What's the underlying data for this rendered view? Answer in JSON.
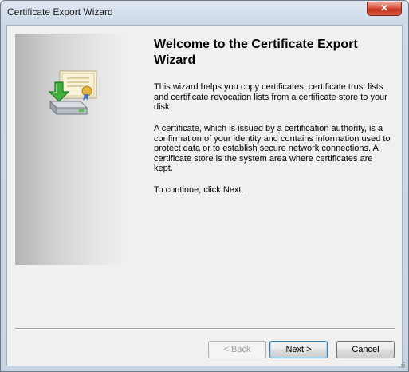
{
  "window": {
    "title": "Certificate Export Wizard",
    "close_label": "✕"
  },
  "wizard": {
    "heading": "Welcome to the Certificate Export Wizard",
    "paragraphs": [
      "This wizard helps you copy certificates, certificate trust lists and certificate revocation lists from a certificate store to your disk.",
      "A certificate, which is issued by a certification authority, is a confirmation of your identity and contains information used to protect data or to establish secure network connections. A certificate store is the system area where certificates are kept.",
      "To continue, click Next."
    ]
  },
  "buttons": {
    "back": "< Back",
    "next": "Next >",
    "cancel": "Cancel"
  },
  "icons": {
    "wizard": "certificate-export-icon",
    "close": "close-icon"
  },
  "colors": {
    "close_button": "#c9432b",
    "default_button_border": "#3c7fb1",
    "disabled_text": "#9b9b9b"
  }
}
